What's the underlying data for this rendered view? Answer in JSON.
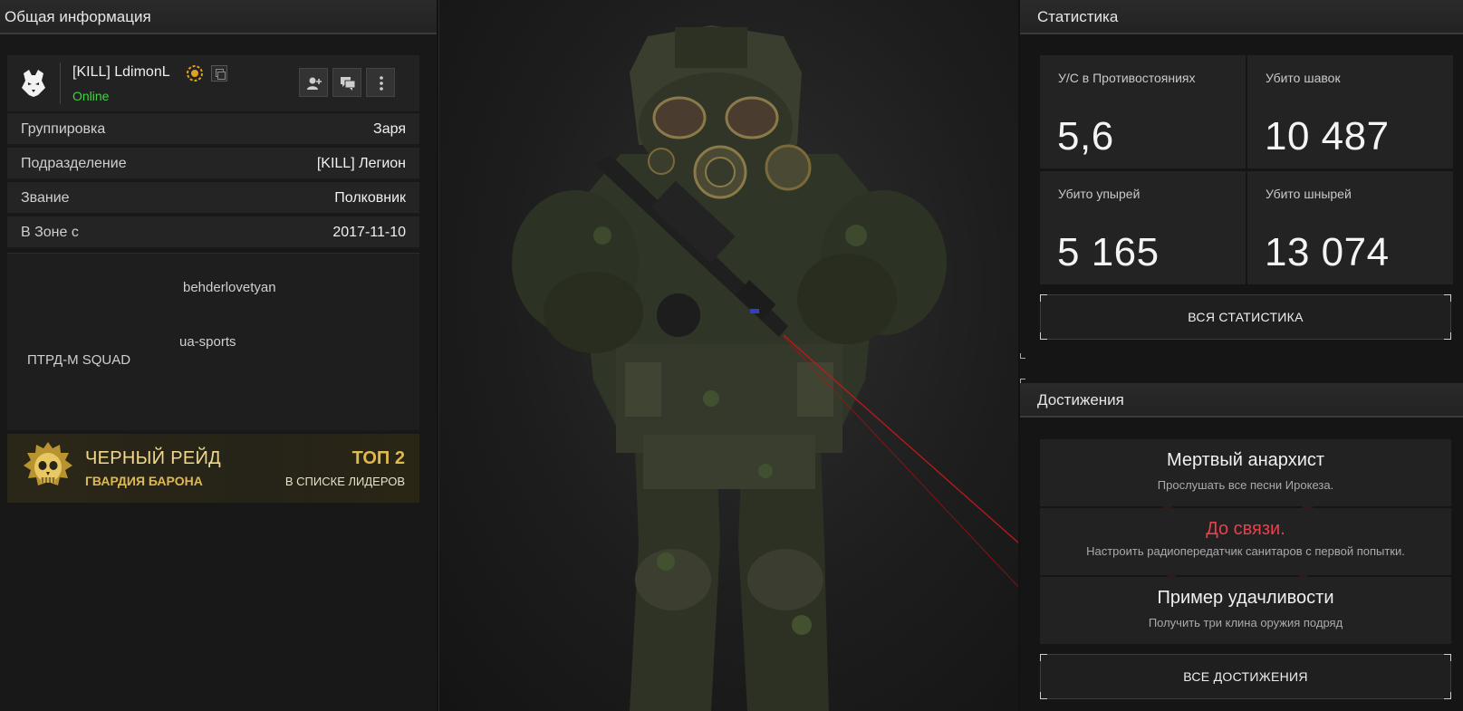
{
  "left_panel": {
    "header": "Общая информация",
    "profile": {
      "nickname": "[KILL] LdimonL",
      "status": "Online",
      "status_color": "#3fd43f",
      "icons": [
        "wolf-icon",
        "rank-badge-icon",
        "copy-icon",
        "add-friend-icon",
        "chat-icon",
        "more-icon"
      ]
    },
    "info_rows": [
      {
        "key": "Группировка",
        "value": "Заря"
      },
      {
        "key": "Подразделение",
        "value": "[KILL] Легион"
      },
      {
        "key": "Звание",
        "value": "Полковник"
      },
      {
        "key": "В Зоне с",
        "value": "2017-11-10"
      }
    ],
    "tags": [
      "behderlovetyan",
      "ua-sports",
      "ПТРД-М SQUAD"
    ],
    "raid": {
      "title": "ЧЕРНЫЙ РЕЙД",
      "subtitle": "ГВАРДИЯ БАРОНА",
      "top": "ТОП 2",
      "top_sub": "В СПИСКЕ ЛИДЕРОВ",
      "accent": "#e0b94e"
    }
  },
  "right_panel": {
    "stats_header": "Статистика",
    "stats": [
      {
        "label": "У/С в Противостояниях",
        "value": "5,6"
      },
      {
        "label": "Убито шавок",
        "value": "10 487"
      },
      {
        "label": "Убито упырей",
        "value": "5 165"
      },
      {
        "label": "Убито шнырей",
        "value": "13 074"
      }
    ],
    "all_stats_button": "ВСЯ СТАТИСТИКА",
    "achievements_header": "Достижения",
    "achievements": [
      {
        "title": "Мертвый анархист",
        "desc": "Прослушать все песни Ирокеза."
      },
      {
        "title": "До связи.",
        "desc": "Настроить радиопередатчик санитаров с первой попытки."
      },
      {
        "title": "Пример удачливости",
        "desc": "Получить три клина оружия подряд"
      }
    ],
    "highlight_color": "#e8404d",
    "all_achievements_button": "ВСЕ ДОСТИЖЕНИЯ"
  }
}
